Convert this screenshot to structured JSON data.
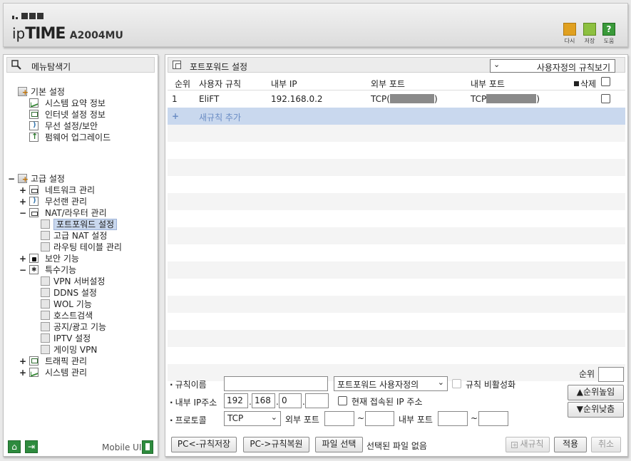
{
  "header": {
    "brand_prefix": "ip",
    "brand_main": "TIME",
    "model": "A2004MU",
    "buttons": [
      {
        "label": "다시",
        "icon": "restart-icon",
        "color": "#e0a020"
      },
      {
        "label": "저장",
        "icon": "save-icon",
        "color": "#8dc040"
      },
      {
        "label": "도움",
        "icon": "help-icon",
        "color": "#3a9a3a"
      }
    ]
  },
  "sidebar": {
    "title": "메뉴탐색기",
    "groups": [
      {
        "label": "기본 설정",
        "children": [
          "시스템 요약 정보",
          "인터넷 설정 정보",
          "무선 설정/보안",
          "펌웨어 업그레이드"
        ]
      },
      {
        "label": "고급 설정",
        "toggle": "−"
      }
    ],
    "advanced": {
      "network": "네트워크 관리",
      "wireless": "무선랜 관리",
      "nat": "NAT/라우터 관리",
      "nat_children": [
        "포트포워드 설정",
        "고급 NAT 설정",
        "라우팅 테이블 관리"
      ],
      "security": "보안 기능",
      "special": "특수기능",
      "special_children": [
        "VPN 서버설정",
        "DDNS 설정",
        "WOL 기능",
        "호스트검색",
        "공지/광고 기능",
        "IPTV 설정",
        "게이밍 VPN"
      ],
      "traffic": "트래픽 관리",
      "system": "시스템 관리"
    },
    "toggles": {
      "plus": "+",
      "minus": "−"
    },
    "mobile_label": "Mobile UI"
  },
  "main": {
    "title": "포트포워드 설정",
    "view_select": "사용자정의 규칙보기",
    "columns": {
      "order": "순위",
      "rule": "사용자 규칙",
      "internal_ip": "내부 IP",
      "external_port": "외부 포트",
      "internal_port": "내부 포트",
      "delete": "삭제"
    },
    "rules": [
      {
        "order": "1",
        "name": "EliFT",
        "internal_ip": "192.168.0.2",
        "external_port": "TCP(",
        "internal_port": "TCP",
        "close_paren": ")"
      }
    ],
    "add_rule": "새규칙 추가",
    "add_rule_symbol": "+"
  },
  "form": {
    "rule_name_label": "규칙이름",
    "rule_name_value": "",
    "type_select": "포트포워드 사용자정의",
    "disable_label": "규칙 비활성화",
    "ip_label": "내부 IP주소",
    "ip_parts": [
      "192",
      "168",
      "0",
      ""
    ],
    "current_ip_label": "현재 접속된 IP 주소",
    "protocol_label": "프로토콜",
    "protocol_value": "TCP",
    "ext_port_label": "외부 포트",
    "int_port_label": "내부 포트",
    "tilde": "~",
    "order_label": "순위",
    "order_value": "",
    "priority_up": "▲순위높임",
    "priority_down": "▼순위낮춤",
    "save_to_pc": "PC<-규칙저장",
    "restore_from_pc": "PC->규칙복원",
    "file_select": "파일 선택",
    "no_file": "선택된 파일 없음",
    "new_rule": "새규칙",
    "apply": "적용",
    "cancel": "취소"
  }
}
